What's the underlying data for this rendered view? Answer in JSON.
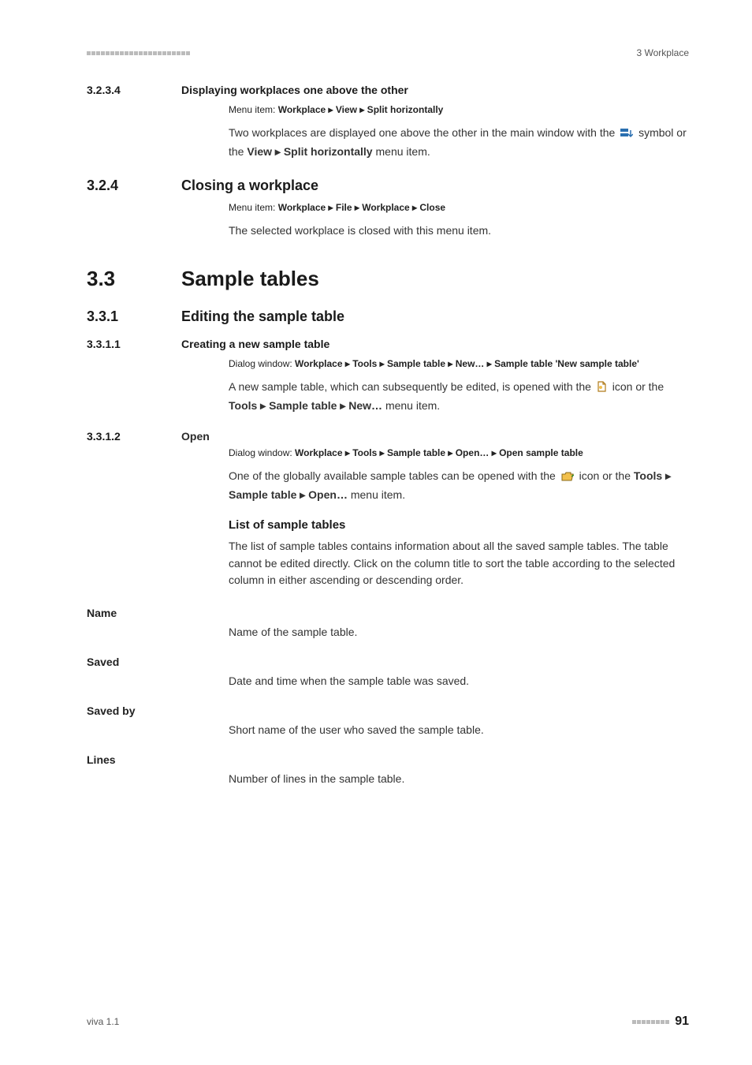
{
  "header": {
    "right": "3 Workplace"
  },
  "sections": {
    "s1": {
      "num": "3.2.3.4",
      "title": "Displaying workplaces one above the other",
      "menu_prefix": "Menu item: ",
      "menu_bold": "Workplace ▸ View ▸ Split horizontally",
      "p1a": "Two workplaces are displayed one above the other in the main window with the ",
      "p1b": " symbol or the ",
      "p1c": "View ▸ Split horizontally",
      "p1d": " menu item."
    },
    "s2": {
      "num": "3.2.4",
      "title": "Closing a workplace",
      "menu_prefix": "Menu item: ",
      "menu_bold": "Workplace ▸ File ▸ Workplace ▸ Close",
      "p1": "The selected workplace is closed with this menu item."
    },
    "s3": {
      "num": "3.3",
      "title": "Sample tables"
    },
    "s4": {
      "num": "3.3.1",
      "title": "Editing the sample table"
    },
    "s5": {
      "num": "3.3.1.1",
      "title": "Creating a new sample table",
      "menu_prefix": "Dialog window: ",
      "menu_bold": "Workplace ▸ Tools ▸ Sample table ▸ New… ▸ Sample table 'New sample table'",
      "p1a": "A new sample table, which can subsequently be edited, is opened with the ",
      "p1b": " icon or the ",
      "p1c": "Tools ▸ Sample table ▸ New…",
      "p1d": " menu item."
    },
    "s6": {
      "num": "3.3.1.2",
      "title": "Open",
      "menu_prefix": "Dialog window: ",
      "menu_bold": "Workplace ▸ Tools ▸ Sample table ▸ Open… ▸ Open sample table",
      "p1a": "One of the globally available sample tables can be opened with the ",
      "p1b": " icon or the ",
      "p1c": "Tools ▸ Sample table ▸ Open…",
      "p1d": " menu item.",
      "list_heading": "List of sample tables",
      "p2": "The list of sample tables contains information about all the saved sample tables. The table cannot be edited directly. Click on the column title to sort the table according to the selected column in either ascending or descending order."
    },
    "fields": {
      "name": {
        "label": "Name",
        "desc": "Name of the sample table."
      },
      "saved": {
        "label": "Saved",
        "desc": "Date and time when the sample table was saved."
      },
      "savedby": {
        "label": "Saved by",
        "desc": "Short name of the user who saved the sample table."
      },
      "lines": {
        "label": "Lines",
        "desc": "Number of lines in the sample table."
      }
    }
  },
  "footer": {
    "left": "viva 1.1",
    "page": "91"
  }
}
